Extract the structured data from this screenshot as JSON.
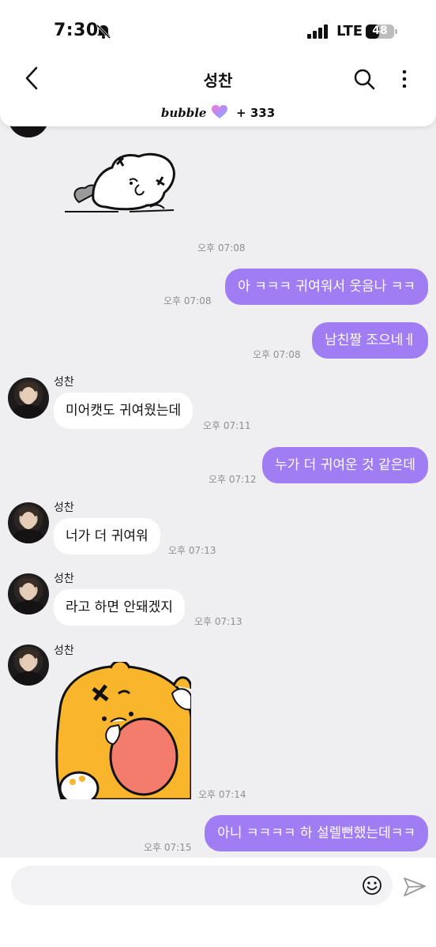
{
  "status": {
    "time": "7:30",
    "network": "LTE",
    "battery": "48"
  },
  "header": {
    "title": "성찬",
    "brand": "bubble",
    "count": "+ 333"
  },
  "messages": [
    {
      "kind": "sticker",
      "from": "in",
      "time": "오후 07:08"
    },
    {
      "kind": "text",
      "from": "out",
      "text": "아 ㅋㅋㅋ 귀여워서 웃음나 ㅋㅋ",
      "time": "오후 07:08"
    },
    {
      "kind": "text",
      "from": "out",
      "text": "남친짤 조으네ㅔ",
      "time": "오후 07:08"
    },
    {
      "kind": "text",
      "from": "in",
      "sender": "성찬",
      "text": "미어캣도 귀여웠는데",
      "time": "오후 07:11"
    },
    {
      "kind": "text",
      "from": "out",
      "text": "누가 더 귀여운 것 같은데",
      "time": "오후 07:12"
    },
    {
      "kind": "text",
      "from": "in",
      "sender": "성찬",
      "text": "너가 더 귀여워",
      "time": "오후 07:13"
    },
    {
      "kind": "text",
      "from": "in",
      "sender": "성찬",
      "text": "라고 하면 안돼겠지",
      "time": "오후 07:13"
    },
    {
      "kind": "sticker",
      "from": "in",
      "sender": "성찬",
      "time": "오후 07:14"
    },
    {
      "kind": "text",
      "from": "out",
      "text": "아니 ㅋㅋㅋㅋ 하 설렐뻔했는데ㅋㅋ",
      "time": "오후 07:15"
    }
  ],
  "composer": {
    "placeholder": ""
  },
  "colors": {
    "outgoing": "#a07df3",
    "background": "#efeff1"
  },
  "icons": [
    "bell-off-icon",
    "signal-icon",
    "battery-icon",
    "back-icon",
    "search-icon",
    "more-icon",
    "heart-icon",
    "emoji-icon",
    "send-icon"
  ]
}
